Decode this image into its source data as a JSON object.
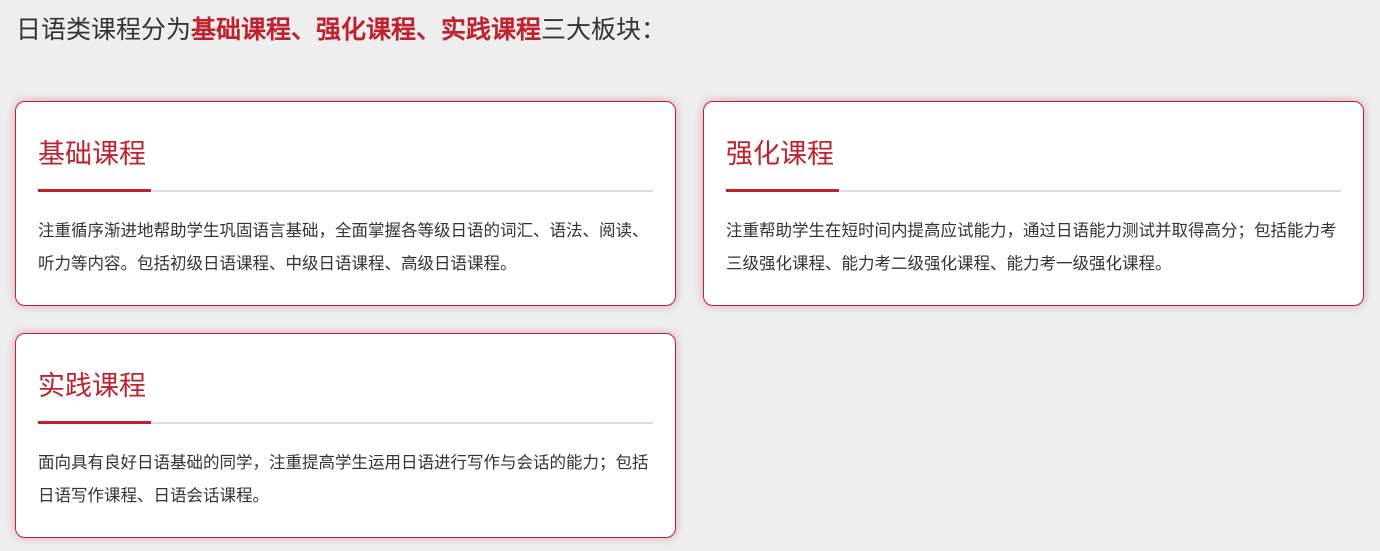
{
  "intro": {
    "prefix": "日语类课程分为",
    "highlight": "基础课程、强化课程、实践课程",
    "suffix": "三大板块："
  },
  "colors": {
    "accent": "#c0212e",
    "background": "#eeeeee",
    "card_background": "#ffffff",
    "text": "#333333",
    "divider": "#dddddd"
  },
  "cards": [
    {
      "title": "基础课程",
      "description": "注重循序渐进地帮助学生巩固语言基础，全面掌握各等级日语的词汇、语法、阅读、听力等内容。包括初级日语课程、中级日语课程、高级日语课程。"
    },
    {
      "title": "强化课程",
      "description": "注重帮助学生在短时间内提高应试能力，通过日语能力测试并取得高分；包括能力考三级强化课程、能力考二级强化课程、能力考一级强化课程。"
    },
    {
      "title": "实践课程",
      "description": "面向具有良好日语基础的同学，注重提高学生运用日语进行写作与会话的能力；包括日语写作课程、日语会话课程。"
    }
  ]
}
